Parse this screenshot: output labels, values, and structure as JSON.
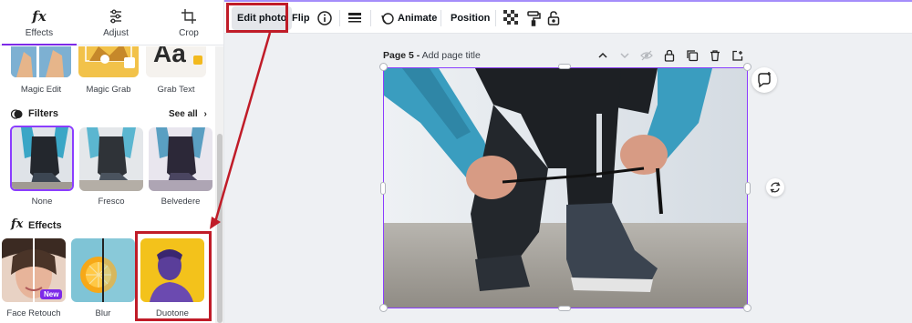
{
  "panel": {
    "tabs": [
      {
        "label": "Effects",
        "icon": "fx-icon"
      },
      {
        "label": "Adjust",
        "icon": "sliders-icon"
      },
      {
        "label": "Crop",
        "icon": "crop-icon"
      }
    ],
    "tools": [
      {
        "label": "Magic Edit"
      },
      {
        "label": "Magic Grab"
      },
      {
        "label": "Grab Text",
        "thumb_text": "Aa"
      }
    ],
    "filters": {
      "heading": "Filters",
      "see_all": "See all",
      "items": [
        {
          "label": "None"
        },
        {
          "label": "Fresco"
        },
        {
          "label": "Belvedere"
        }
      ]
    },
    "effects": {
      "heading": "Effects",
      "items": [
        {
          "label": "Face Retouch",
          "badge": "New"
        },
        {
          "label": "Blur"
        },
        {
          "label": "Duotone"
        }
      ]
    }
  },
  "toolbar": {
    "edit_photo": "Edit photo",
    "flip": "Flip",
    "animate": "Animate",
    "position": "Position"
  },
  "canvas": {
    "page_number": "Page 5 -",
    "page_title_placeholder": "Add page title"
  },
  "colors": {
    "accent": "#8b3dff",
    "annotation": "#c01c28",
    "badge": "#7d2ae8"
  }
}
